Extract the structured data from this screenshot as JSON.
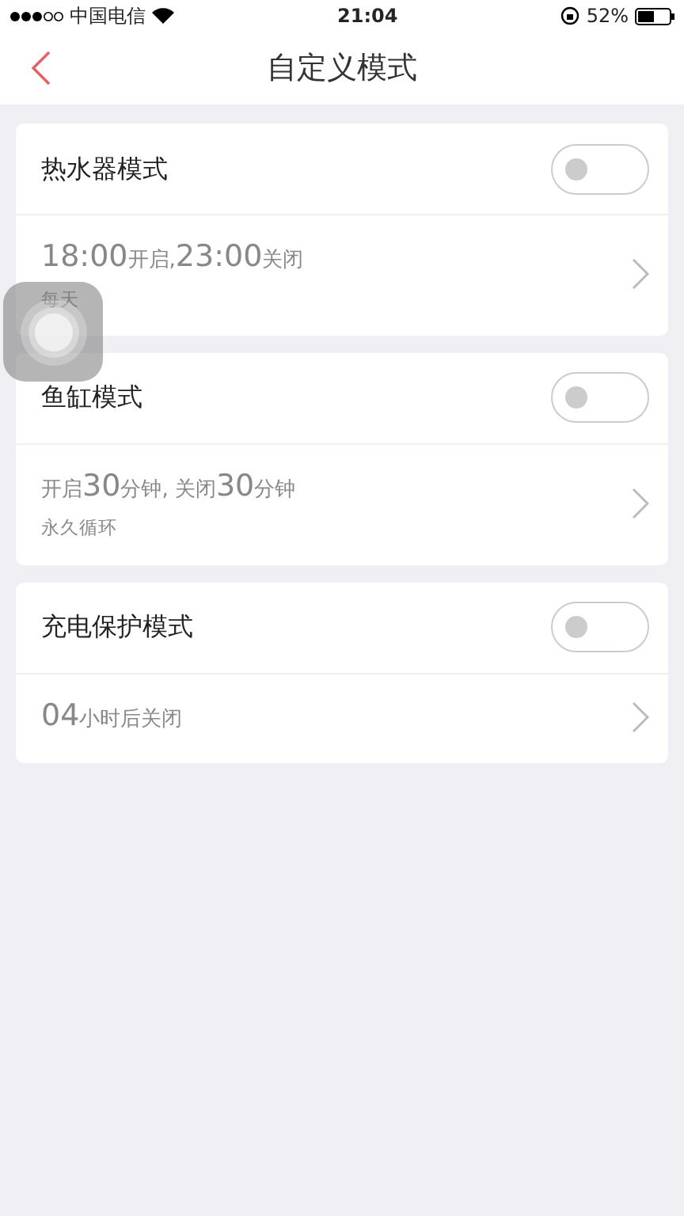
{
  "status_bar": {
    "carrier": "中国电信",
    "time": "21:04",
    "battery": "52%"
  },
  "nav": {
    "title": "自定义模式"
  },
  "modes": [
    {
      "name": "热水器模式",
      "on": false,
      "schedule": [
        {
          "kind": "big",
          "text": "18:00"
        },
        {
          "kind": "small",
          "text": "开启,"
        },
        {
          "kind": "big",
          "text": "23:00"
        },
        {
          "kind": "small",
          "text": "关闭"
        }
      ],
      "repeat": "每天"
    },
    {
      "name": "鱼缸模式",
      "on": false,
      "schedule": [
        {
          "kind": "small",
          "text": "开启"
        },
        {
          "kind": "big",
          "text": "30"
        },
        {
          "kind": "small",
          "text": "分钟, 关闭"
        },
        {
          "kind": "big",
          "text": "30"
        },
        {
          "kind": "small",
          "text": "分钟"
        }
      ],
      "repeat": "永久循环"
    },
    {
      "name": "充电保护模式",
      "on": false,
      "schedule": [
        {
          "kind": "big",
          "text": "04"
        },
        {
          "kind": "small",
          "text": "小时后关闭"
        }
      ]
    }
  ]
}
